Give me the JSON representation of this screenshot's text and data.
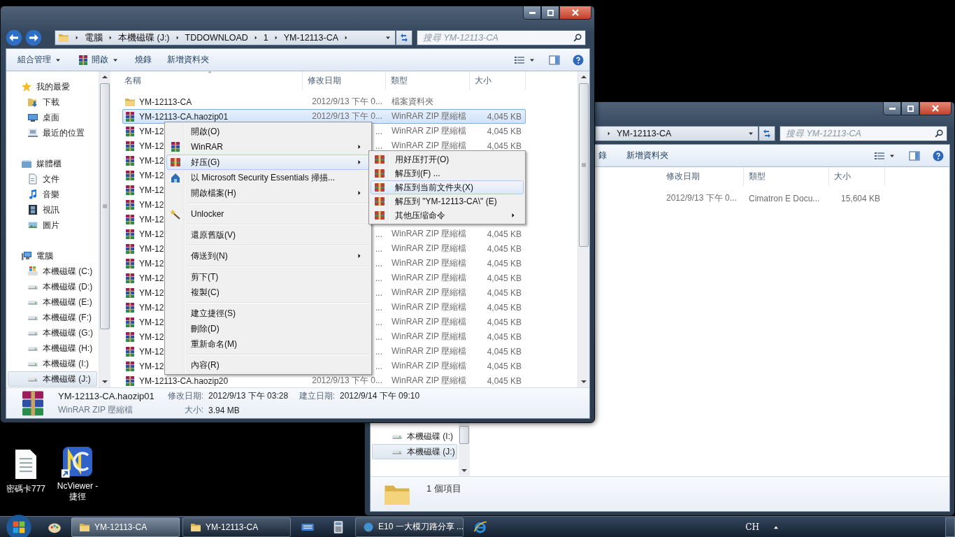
{
  "left_window": {
    "address": [
      "電腦",
      "本機磁碟 (J:)",
      "TDDOWNLOAD",
      "1",
      "YM-12113-CA"
    ],
    "search": {
      "placeholder": "搜尋 YM-12113-CA"
    },
    "toolbar": [
      {
        "label": "組合管理",
        "dropdown": true
      },
      {
        "label": "開啟",
        "dropdown": true
      },
      {
        "label": "燒錄",
        "dropdown": false
      },
      {
        "label": "新增資料夾",
        "dropdown": false
      }
    ],
    "nav": [
      {
        "label": "我的最愛",
        "selected": false,
        "children": [
          {
            "label": "下載",
            "selected": false
          },
          {
            "label": "桌面",
            "selected": false
          },
          {
            "label": "最近的位置",
            "selected": false
          }
        ]
      },
      {
        "label": "媒體櫃",
        "selected": false,
        "children": [
          {
            "label": "文件",
            "selected": false
          },
          {
            "label": "音樂",
            "selected": false
          },
          {
            "label": "視訊",
            "selected": false
          },
          {
            "label": "圖片",
            "selected": false
          }
        ]
      },
      {
        "label": "電腦",
        "selected": false,
        "children": [
          {
            "label": "本機磁碟 (C:)",
            "selected": false
          },
          {
            "label": "本機磁碟 (D:)",
            "selected": false
          },
          {
            "label": "本機磁碟 (E:)",
            "selected": false
          },
          {
            "label": "本機磁碟 (F:)",
            "selected": false
          },
          {
            "label": "本機磁碟 (G:)",
            "selected": false
          },
          {
            "label": "本機磁碟 (H:)",
            "selected": false
          },
          {
            "label": "本機磁碟 (I:)",
            "selected": false
          },
          {
            "label": "本機磁碟 (J:)",
            "selected": true
          }
        ]
      }
    ],
    "columns": [
      "名稱",
      "修改日期",
      "類型",
      "大小"
    ],
    "rows": [
      {
        "kind": "folder",
        "name": "YM-12113-CA",
        "date": "2012/9/13 下午 0...",
        "type": "檔案資料夾",
        "selected": false
      },
      {
        "kind": "archive",
        "name": "YM-12113-CA.haozip01",
        "date": "2012/9/13 下午 0...",
        "type": "WinRAR ZIP 壓縮檔",
        "size": "4,045 KB",
        "selected": true
      },
      {
        "kind": "archive",
        "name": "YM-12",
        "date": "...",
        "type": "WinRAR ZIP 壓縮檔",
        "size": "4,045 KB",
        "selected": false
      },
      {
        "kind": "archive",
        "name": "YM-12",
        "date": "...",
        "type": "WinRAR ZIP 壓縮檔",
        "size": "4,045 KB",
        "selected": false
      },
      {
        "kind": "archive",
        "name": "YM-12",
        "selected": false
      },
      {
        "kind": "archive",
        "name": "YM-12",
        "selected": false
      },
      {
        "kind": "archive",
        "name": "YM-12",
        "selected": false
      },
      {
        "kind": "archive",
        "name": "YM-12",
        "selected": false
      },
      {
        "kind": "archive",
        "name": "YM-12",
        "selected": false
      },
      {
        "kind": "archive",
        "name": "YM-12",
        "date": "...",
        "type": "WinRAR ZIP 壓縮檔",
        "size": "4,045 KB",
        "selected": false
      },
      {
        "kind": "archive",
        "name": "YM-12",
        "date": "...",
        "type": "WinRAR ZIP 壓縮檔",
        "size": "4,045 KB",
        "selected": false
      },
      {
        "kind": "archive",
        "name": "YM-12",
        "date": "...",
        "type": "WinRAR ZIP 壓縮檔",
        "size": "4,045 KB",
        "selected": false
      },
      {
        "kind": "archive",
        "name": "YM-12",
        "date": "...",
        "type": "WinRAR ZIP 壓縮檔",
        "size": "4,045 KB",
        "selected": false
      },
      {
        "kind": "archive",
        "name": "YM-12",
        "date": "...",
        "type": "WinRAR ZIP 壓縮檔",
        "size": "4,045 KB",
        "selected": false
      },
      {
        "kind": "archive",
        "name": "YM-12",
        "date": "...",
        "type": "WinRAR ZIP 壓縮檔",
        "size": "4,045 KB",
        "selected": false
      },
      {
        "kind": "archive",
        "name": "YM-12",
        "date": "...",
        "type": "WinRAR ZIP 壓縮檔",
        "size": "4,045 KB",
        "selected": false
      },
      {
        "kind": "archive",
        "name": "YM-12",
        "date": "...",
        "type": "WinRAR ZIP 壓縮檔",
        "size": "4,045 KB",
        "selected": false
      },
      {
        "kind": "archive",
        "name": "YM-12",
        "date": "...",
        "type": "WinRAR ZIP 壓縮檔",
        "size": "4,045 KB",
        "selected": false
      },
      {
        "kind": "archive",
        "name": "YM-12",
        "date": "...",
        "type": "WinRAR ZIP 壓縮檔",
        "size": "4,045 KB",
        "selected": false
      },
      {
        "kind": "archive",
        "name": "YM-12113-CA.haozip20",
        "date": "2012/9/13 下午 0...",
        "type": "WinRAR ZIP 壓縮檔",
        "size": "4,045 KB",
        "selected": false
      }
    ],
    "details": {
      "name": "YM-12113-CA.haozip01",
      "type": "WinRAR ZIP 壓縮檔",
      "fields": [
        [
          {
            "label": "修改日期:",
            "value": "2012/9/13 下午 03:28"
          },
          {
            "label": "建立日期:",
            "value": "2012/9/14 下午 09:10"
          }
        ],
        [
          {
            "label": "大小:",
            "value": "3.94 MB"
          }
        ]
      ]
    }
  },
  "context_menu": {
    "items": [
      {
        "kind": "item",
        "label": "開啟(O)",
        "submenu": false,
        "selected": false
      },
      {
        "kind": "item",
        "label": "WinRAR",
        "submenu": true,
        "selected": false
      },
      {
        "kind": "item",
        "label": "好压(G)",
        "submenu": true,
        "selected": true
      },
      {
        "kind": "item",
        "label": "以 Microsoft Security Essentials 掃描...",
        "submenu": false,
        "selected": false
      },
      {
        "kind": "item",
        "label": "開啟檔案(H)",
        "submenu": true,
        "selected": false
      },
      {
        "kind": "separator"
      },
      {
        "kind": "item",
        "label": "Unlocker",
        "submenu": false,
        "selected": false
      },
      {
        "kind": "separator"
      },
      {
        "kind": "item",
        "label": "還原舊版(V)",
        "submenu": false,
        "selected": false
      },
      {
        "kind": "separator"
      },
      {
        "kind": "item",
        "label": "傳送到(N)",
        "submenu": true,
        "selected": false
      },
      {
        "kind": "separator"
      },
      {
        "kind": "item",
        "label": "剪下(T)",
        "submenu": false,
        "selected": false
      },
      {
        "kind": "item",
        "label": "複製(C)",
        "submenu": false,
        "selected": false
      },
      {
        "kind": "separator"
      },
      {
        "kind": "item",
        "label": "建立捷徑(S)",
        "submenu": false,
        "selected": false
      },
      {
        "kind": "item",
        "label": "刪除(D)",
        "submenu": false,
        "selected": false
      },
      {
        "kind": "item",
        "label": "重新命名(M)",
        "submenu": false,
        "selected": false
      },
      {
        "kind": "separator"
      },
      {
        "kind": "item",
        "label": "內容(R)",
        "submenu": false,
        "selected": false
      }
    ]
  },
  "submenu": {
    "items": [
      {
        "kind": "item",
        "label": "用好压打开(O)",
        "submenu": false,
        "selected": false
      },
      {
        "kind": "item",
        "label": "解压到(F) ...",
        "submenu": false,
        "selected": false
      },
      {
        "kind": "item",
        "label": "解压到当前文件夹(X)",
        "submenu": false,
        "selected": true
      },
      {
        "kind": "item",
        "label": "解压到 \"YM-12113-CA\\\" (E)",
        "submenu": false,
        "selected": false
      },
      {
        "kind": "item",
        "label": "其他压缩命令",
        "submenu": true,
        "selected": false
      }
    ]
  },
  "right_window": {
    "address_tail": "YM-12113-CA",
    "search": {
      "placeholder": "搜尋 YM-12113-CA"
    },
    "toolbar": [
      "錄",
      "新增資料夾"
    ],
    "columns": [
      "修改日期",
      "類型",
      "大小"
    ],
    "rows": [
      {
        "date": "2012/9/13 下午 0...",
        "type": "Cimatron E Docu...",
        "size": "15,604 KB"
      }
    ],
    "nav": [
      {
        "label": "本機磁碟 (I:)",
        "selected": false
      },
      {
        "label": "本機磁碟 (J:)",
        "selected": true
      }
    ],
    "status": "1 個項目"
  },
  "desktop_icons": [
    {
      "label": "密碼卡777",
      "shortcut": false
    },
    {
      "label": "NcViewer - 捷徑",
      "shortcut": true
    }
  ],
  "taskbar": {
    "items": [
      {
        "kind": "icon"
      },
      {
        "kind": "task",
        "label": "YM-12113-CA",
        "selected": true
      },
      {
        "kind": "task",
        "label": "YM-12113-CA",
        "selected": false
      },
      {
        "kind": "icon"
      },
      {
        "kind": "icon"
      },
      {
        "kind": "task",
        "label": "E10 一大模刀路分享 ...",
        "selected": false
      },
      {
        "kind": "icon"
      }
    ],
    "language": "CH"
  }
}
